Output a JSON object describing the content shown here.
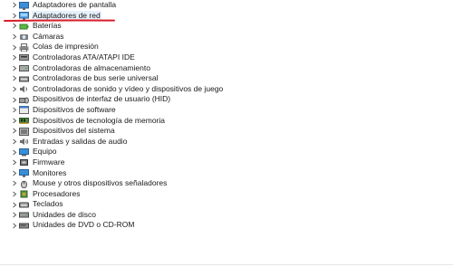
{
  "device_tree": {
    "items": [
      {
        "label": "Adaptadores de pantalla",
        "icon": "display-adapter-icon"
      },
      {
        "label": "Adaptadores de red",
        "icon": "network-adapter-icon",
        "selected": true
      },
      {
        "label": "Baterías",
        "icon": "battery-icon"
      },
      {
        "label": "Cámaras",
        "icon": "camera-icon"
      },
      {
        "label": "Colas de impresión",
        "icon": "printer-icon"
      },
      {
        "label": "Controladoras ATA/ATAPI IDE",
        "icon": "ide-controller-icon"
      },
      {
        "label": "Controladoras de almacenamiento",
        "icon": "storage-controller-icon"
      },
      {
        "label": "Controladoras de bus serie universal",
        "icon": "usb-controller-icon"
      },
      {
        "label": "Controladoras de sonido y vídeo y dispositivos de juego",
        "icon": "sound-icon"
      },
      {
        "label": "Dispositivos de interfaz de usuario (HID)",
        "icon": "hid-icon"
      },
      {
        "label": "Dispositivos de software",
        "icon": "software-device-icon"
      },
      {
        "label": "Dispositivos de tecnología de memoria",
        "icon": "memory-icon"
      },
      {
        "label": "Dispositivos del sistema",
        "icon": "system-device-icon"
      },
      {
        "label": "Entradas y salidas de audio",
        "icon": "audio-io-icon"
      },
      {
        "label": "Equipo",
        "icon": "computer-icon"
      },
      {
        "label": "Firmware",
        "icon": "firmware-icon"
      },
      {
        "label": "Monitores",
        "icon": "monitor-icon"
      },
      {
        "label": "Mouse y otros dispositivos señaladores",
        "icon": "mouse-icon"
      },
      {
        "label": "Procesadores",
        "icon": "processor-icon"
      },
      {
        "label": "Teclados",
        "icon": "keyboard-icon"
      },
      {
        "label": "Unidades de disco",
        "icon": "disk-drive-icon"
      },
      {
        "label": "Unidades de DVD o CD-ROM",
        "icon": "dvd-drive-icon"
      }
    ]
  },
  "colors": {
    "annotation_underline": "#d81e2a",
    "icon_blue": "#3a7bd5",
    "icon_gray": "#6d6d6d"
  }
}
